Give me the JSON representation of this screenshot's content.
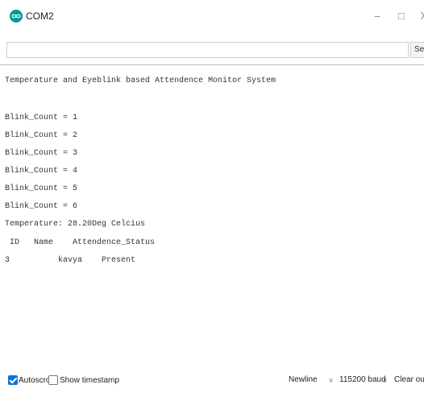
{
  "window": {
    "title": "COM2",
    "minimize_glyph": "–",
    "maximize_glyph": "□",
    "close_glyph": "X"
  },
  "input": {
    "value": "",
    "send_label": "Send"
  },
  "output_lines": [
    "Temperature and Eyeblink based Attendence Monitor System",
    "",
    "Blink_Count = 1",
    "Blink_Count = 2",
    "Blink_Count = 3",
    "Blink_Count = 4",
    "Blink_Count = 5",
    "Blink_Count = 6",
    "Temperature: 28.20Deg Celcius",
    " ID   Name    Attendence_Status",
    "3          kavya    Present"
  ],
  "status": {
    "autoscroll_label": "Autoscroll",
    "autoscroll_checked": true,
    "timestamp_label": "Show timestamp",
    "timestamp_checked": false,
    "line_ending": "Newline",
    "baud": "115200 baud",
    "clear_label": "Clear output"
  }
}
